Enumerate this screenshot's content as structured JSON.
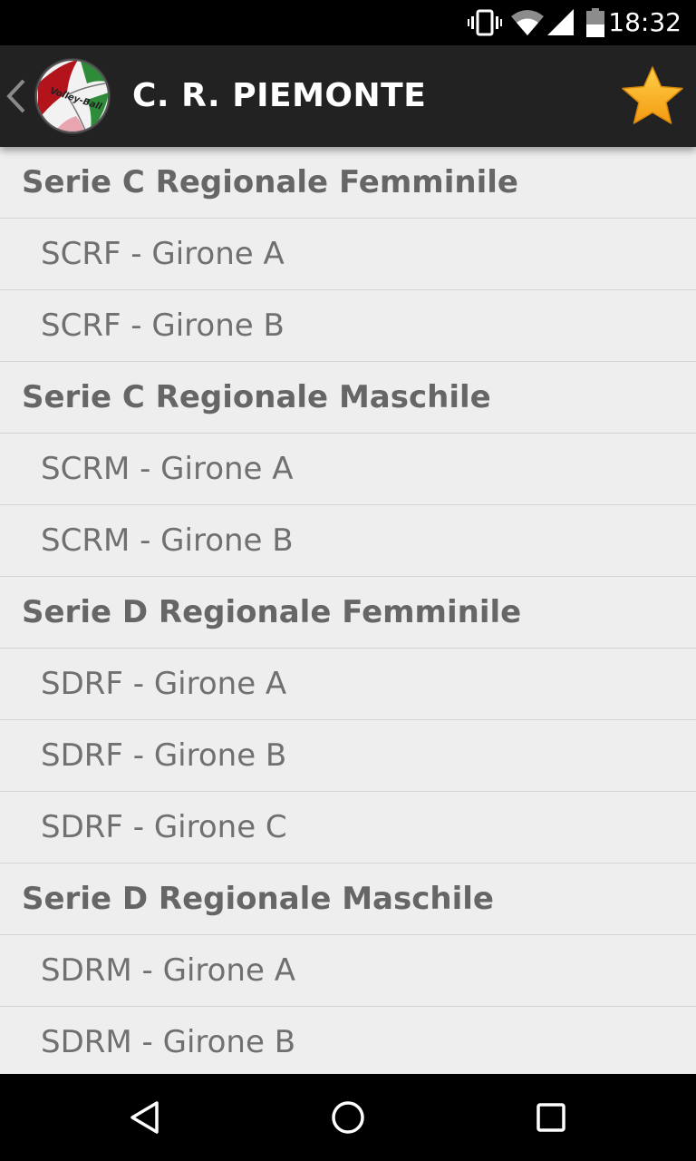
{
  "status_bar": {
    "time": "18:32",
    "icons": [
      "vibrate-icon",
      "wifi-icon",
      "cellular-signal-icon",
      "battery-icon"
    ]
  },
  "action_bar": {
    "title": "C. R. PIEMONTE",
    "logo_text": "Volley-Ball",
    "back_icon": "chevron-left-icon",
    "favorite_icon": "star-icon",
    "favorite_color": "#f5a623"
  },
  "list": {
    "sections": [
      {
        "title": "Serie C Regionale Femminile",
        "items": [
          "SCRF - Girone A",
          "SCRF - Girone B"
        ]
      },
      {
        "title": "Serie C Regionale Maschile",
        "items": [
          "SCRM - Girone A",
          "SCRM - Girone B"
        ]
      },
      {
        "title": "Serie D Regionale Femminile",
        "items": [
          "SDRF - Girone A",
          "SDRF - Girone B",
          "SDRF - Girone C"
        ]
      },
      {
        "title": "Serie D Regionale Maschile",
        "items": [
          "SDRM - Girone A",
          "SDRM - Girone B"
        ]
      }
    ]
  },
  "nav_bar": {
    "icons": [
      "back-triangle-icon",
      "home-circle-icon",
      "recents-square-icon"
    ]
  }
}
